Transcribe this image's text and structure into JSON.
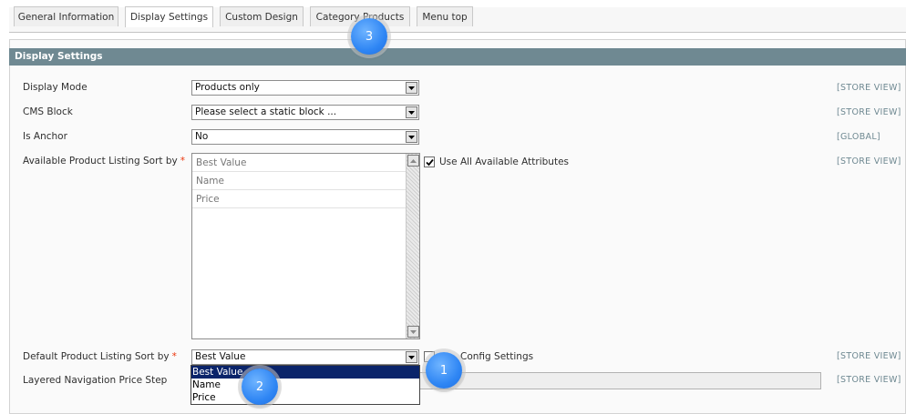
{
  "tabs": [
    {
      "label": "General Information",
      "active": false
    },
    {
      "label": "Display Settings",
      "active": true
    },
    {
      "label": "Custom Design",
      "active": false
    },
    {
      "label": "Category Products",
      "active": false
    },
    {
      "label": "Menu top",
      "active": false
    }
  ],
  "section": {
    "title": "Display Settings"
  },
  "fields": {
    "display_mode": {
      "label": "Display Mode",
      "value": "Products only",
      "scope": "[STORE VIEW]"
    },
    "cms_block": {
      "label": "CMS Block",
      "value": "Please select a static block ...",
      "scope": "[STORE VIEW]"
    },
    "is_anchor": {
      "label": "Is Anchor",
      "value": "No",
      "scope": "[GLOBAL]"
    },
    "available_sort": {
      "label": "Available Product Listing Sort by",
      "required_mark": "*",
      "options": [
        "Best Value",
        "Name",
        "Price"
      ],
      "checkbox_label": "Use All Available Attributes",
      "checkbox_checked": true,
      "scope": "[STORE VIEW]"
    },
    "default_sort": {
      "label": "Default Product Listing Sort by",
      "required_mark": "*",
      "value": "Best Value",
      "checkbox_label": "Config Settings",
      "checkbox_checked": false,
      "dropdown_options": [
        "Best Value",
        "Name",
        "Price"
      ],
      "scope": "[STORE VIEW]"
    },
    "price_step": {
      "label": "Layered Navigation Price Step",
      "value": "",
      "scope": "[STORE VIEW]"
    }
  },
  "badges": [
    "1",
    "2",
    "3"
  ],
  "colors": {
    "section_header": "#6f8992",
    "required": "#eb340a",
    "selected_option": "#0a246a",
    "badge": "#2f86f4"
  }
}
